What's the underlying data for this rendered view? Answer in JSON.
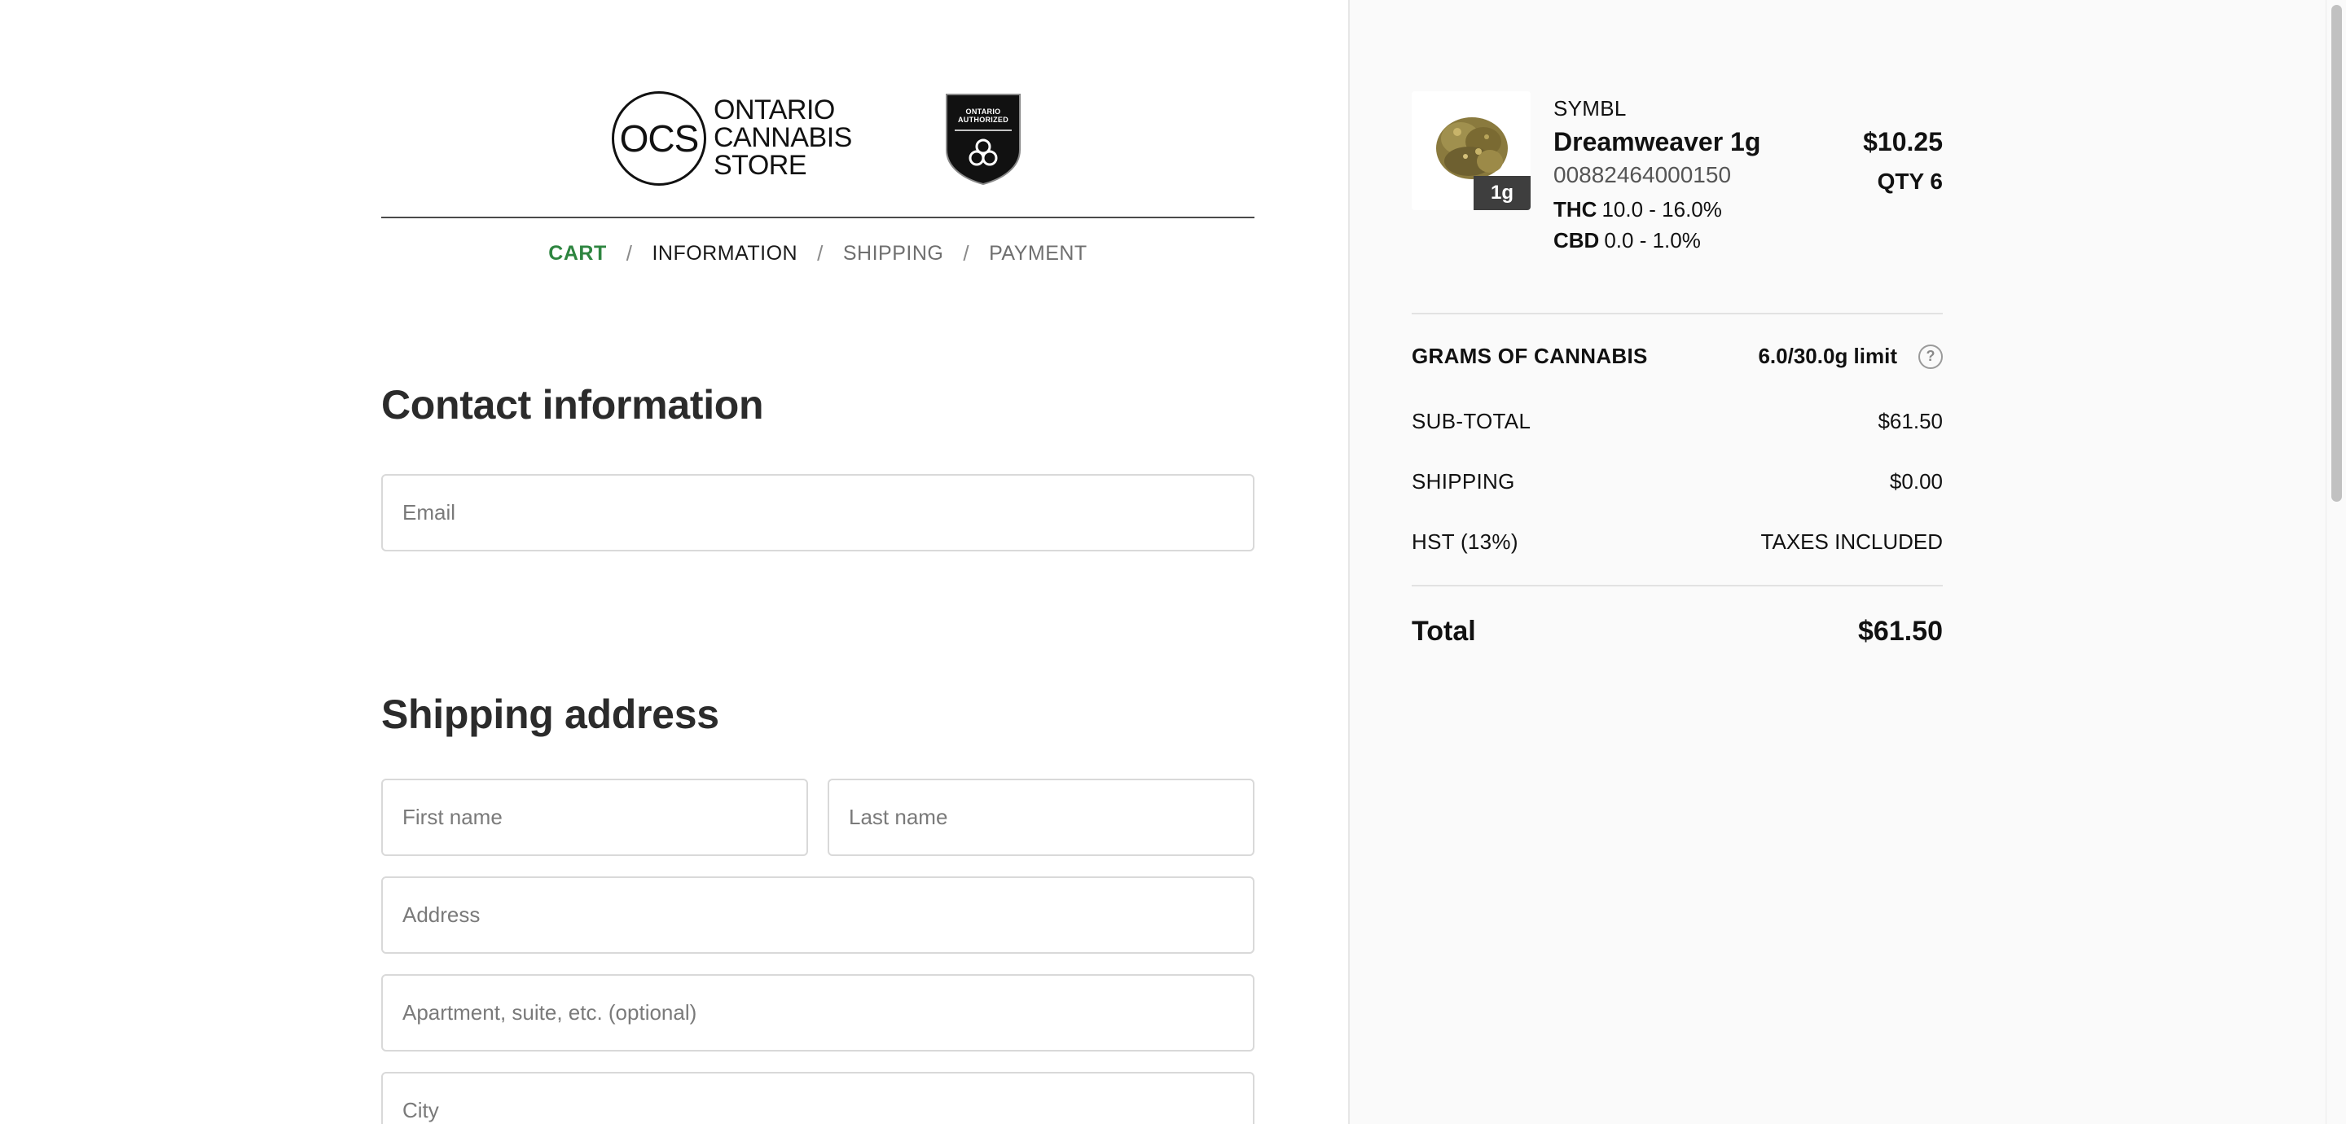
{
  "brand": {
    "monogram": "OCS",
    "wordmark": [
      "ONTARIO",
      "CANNABIS",
      "STORE"
    ],
    "badge_lines": [
      "ONTARIO",
      "AUTHORIZED"
    ]
  },
  "breadcrumb": {
    "cart": "CART",
    "information": "INFORMATION",
    "shipping": "SHIPPING",
    "payment": "PAYMENT",
    "separator": "/"
  },
  "contact": {
    "title": "Contact information",
    "email_placeholder": "Email"
  },
  "shipping_address": {
    "title": "Shipping address",
    "first_name_placeholder": "First name",
    "last_name_placeholder": "Last name",
    "address_placeholder": "Address",
    "apartment_placeholder": "Apartment, suite, etc. (optional)",
    "city_placeholder": "City"
  },
  "order": {
    "item": {
      "brand": "SYMBL",
      "name": "Dreamweaver 1g",
      "sku": "00882464000150",
      "thc_label": "THC",
      "thc_value": "10.0 - 16.0%",
      "cbd_label": "CBD",
      "cbd_value": "0.0 - 1.0%",
      "price": "$10.25",
      "qty": "QTY 6",
      "badge": "1g"
    },
    "grams_label": "GRAMS OF CANNABIS",
    "grams_value": "6.0/30.0g limit",
    "help_glyph": "?",
    "subtotal_label": "SUB-TOTAL",
    "subtotal_value": "$61.50",
    "shipping_label": "SHIPPING",
    "shipping_value": "$0.00",
    "hst_label": "HST (13%)",
    "hst_value": "TAXES INCLUDED",
    "total_label": "Total",
    "total_value": "$61.50"
  },
  "colors": {
    "accent_green": "#2e8540",
    "sidebar_bg": "#fafafa",
    "input_border": "#d9d9d9"
  }
}
